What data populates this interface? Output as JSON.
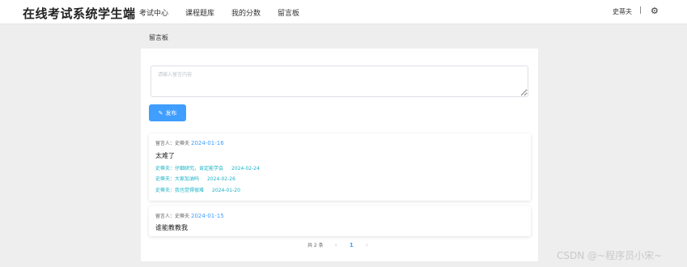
{
  "header": {
    "brand": "在线考试系统学生端",
    "nav": [
      "考试中心",
      "课程题库",
      "我的分数",
      "留言板"
    ],
    "user_name": "史蒂夫",
    "separator": "|"
  },
  "page": {
    "title": "留言板"
  },
  "composer": {
    "placeholder": "请输入留言内容",
    "publish_label": "发布"
  },
  "messages": [
    {
      "author_label": "留言人：史蒂夫",
      "date": "2024-01-16",
      "content": "太难了",
      "replies": [
        {
          "text": "史蒂夫：仔细研究，肯定能学会",
          "date": "2024-02-24"
        },
        {
          "text": "史蒂夫：大家加油吗",
          "date": "2024-02-26"
        },
        {
          "text": "史蒂夫：我也觉得很难",
          "date": "2024-01-20"
        }
      ]
    },
    {
      "author_label": "留言人：史蒂夫",
      "date": "2024-01-15",
      "content": "谁能教教我",
      "replies": []
    }
  ],
  "pagination": {
    "total": "共 2 条",
    "current_page": "1",
    "prev": "‹",
    "next": "›"
  },
  "watermark": "CSDN @~程序员小宋~",
  "colors": {
    "accent": "#409eff",
    "reply": "#17b3c7",
    "background": "#eeeeee"
  },
  "icons": {
    "settings": "gear-icon",
    "publish": "edit-icon"
  }
}
